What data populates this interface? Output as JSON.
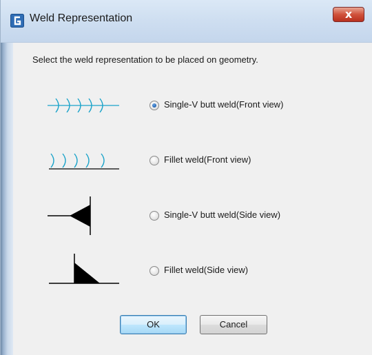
{
  "window": {
    "title": "Weld Representation",
    "close_label": "x"
  },
  "dialog": {
    "instruction": "Select the weld representation to be placed on geometry."
  },
  "options": [
    {
      "label": "Single-V butt weld(Front view)",
      "selected": true,
      "icon": "single-v-butt-weld-front-symbol"
    },
    {
      "label": "Fillet weld(Front view)",
      "selected": false,
      "icon": "fillet-weld-front-symbol"
    },
    {
      "label": "Single-V butt weld(Side view)",
      "selected": false,
      "icon": "single-v-butt-weld-side-symbol"
    },
    {
      "label": "Fillet weld(Side view)",
      "selected": false,
      "icon": "fillet-weld-side-symbol"
    }
  ],
  "buttons": {
    "ok": "OK",
    "cancel": "Cancel"
  },
  "colors": {
    "weld_front_symbol": "#1aa3c9",
    "weld_side_symbol": "#000000",
    "radio_selected": "#1f5fae"
  }
}
